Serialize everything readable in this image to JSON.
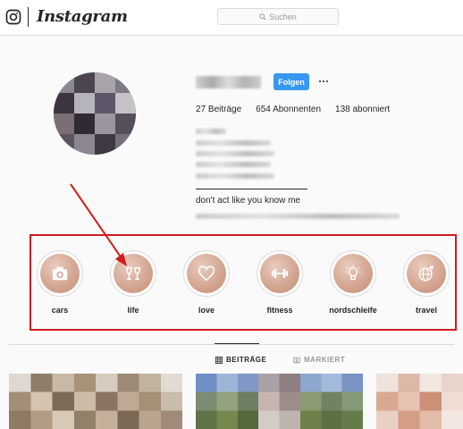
{
  "header": {
    "wordmark": "Instagram",
    "search_placeholder": "Suchen",
    "icons": [
      "instagram-glyph-icon",
      "search-icon"
    ]
  },
  "profile": {
    "follow_label": "Folgen",
    "stats": {
      "posts": "27 Beiträge",
      "followers": "654 Abonnenten",
      "following": "138 abonniert"
    },
    "tagline": "don't act like you know me"
  },
  "highlights": [
    {
      "label": "cars",
      "icon": "camera-icon"
    },
    {
      "label": "life",
      "icon": "cheers-glasses-icon"
    },
    {
      "label": "love",
      "icon": "heart-icon"
    },
    {
      "label": "fitness",
      "icon": "dumbbell-icon"
    },
    {
      "label": "nordschleife",
      "icon": "lightbulb-icon"
    },
    {
      "label": "travel",
      "icon": "globe-icon"
    }
  ],
  "tabs": [
    {
      "label": "BEITRÄGE",
      "icon": "grid-icon",
      "active": true
    },
    {
      "label": "MARKIERT",
      "icon": "tag-icon",
      "active": false
    }
  ],
  "colors": {
    "accent": "#3897f0",
    "annotation": "#d01c1c",
    "highlight_fill": "#d7ab98"
  }
}
